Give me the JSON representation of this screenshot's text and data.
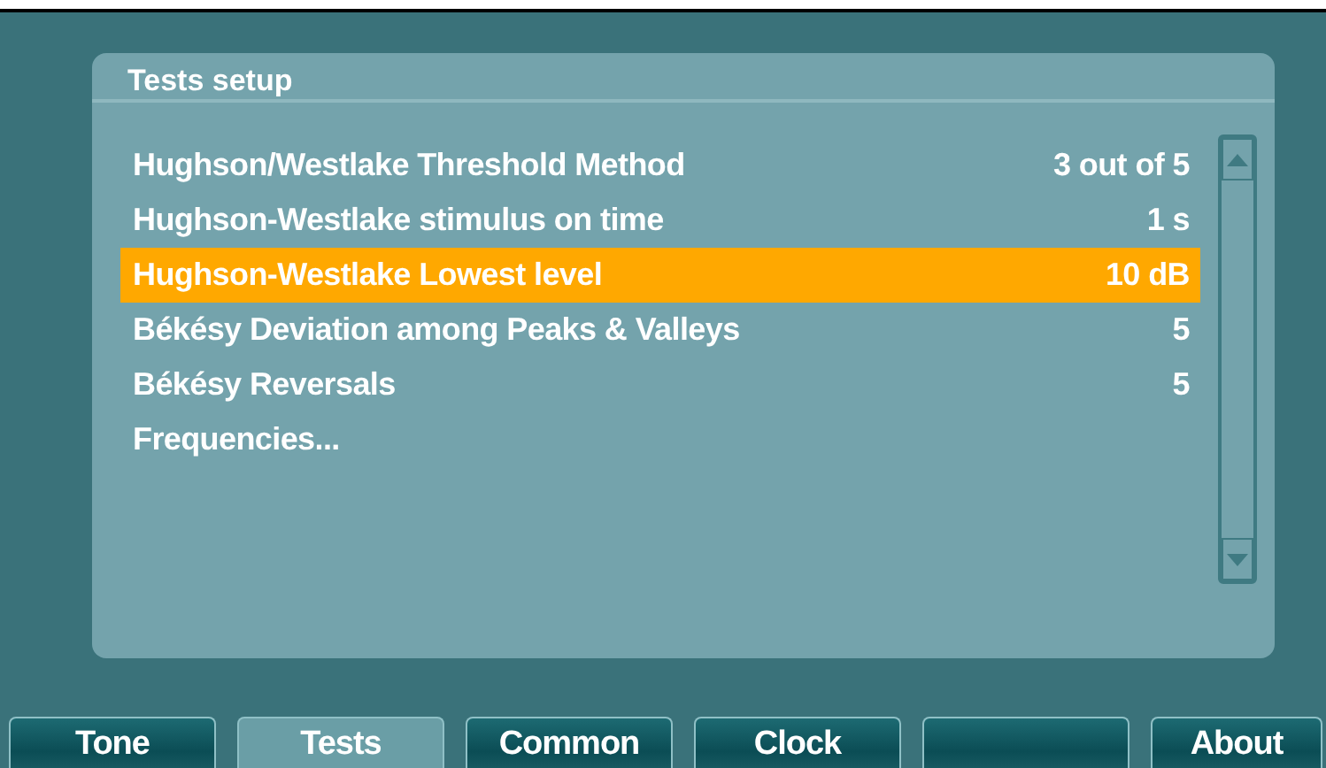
{
  "panel": {
    "title": "Tests setup",
    "settings": [
      {
        "label": "Hughson/Westlake Threshold Method",
        "value": "3 out of 5",
        "selected": false
      },
      {
        "label": "Hughson-Westlake stimulus on time",
        "value": "1 s",
        "selected": false
      },
      {
        "label": "Hughson-Westlake Lowest level",
        "value": "10 dB",
        "selected": true
      },
      {
        "label": "Békésy Deviation among Peaks & Valleys",
        "value": "5",
        "selected": false
      },
      {
        "label": "Békésy Reversals",
        "value": "5",
        "selected": false
      },
      {
        "label": "Frequencies...",
        "selected": false
      }
    ]
  },
  "tabs": [
    {
      "label": "Tone",
      "selected": false
    },
    {
      "label": "Tests",
      "selected": true
    },
    {
      "label": "Common",
      "selected": false
    },
    {
      "label": "Clock",
      "selected": false
    },
    {
      "selected": false
    },
    {
      "label": "About",
      "selected": false
    }
  ]
}
